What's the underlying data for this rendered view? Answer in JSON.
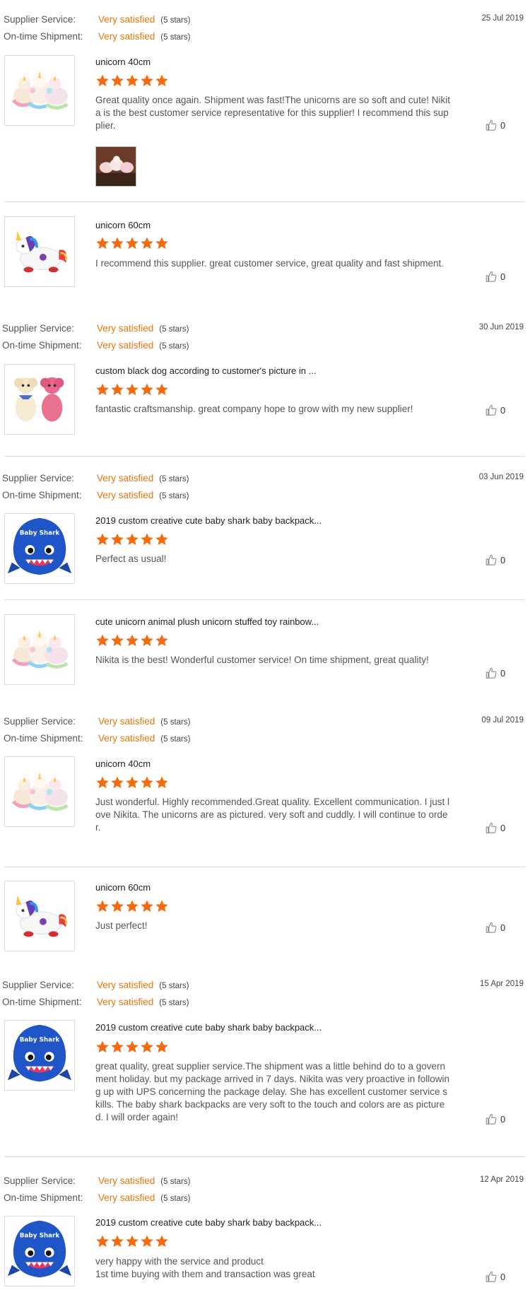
{
  "labels": {
    "supplier_service": "Supplier Service:",
    "on_time_shipment": "On-time Shipment:",
    "rating_text": "Very satisfied",
    "rating_stars": "(5 stars)"
  },
  "colors": {
    "accent": "#e8760c",
    "star": "#f26b10"
  },
  "reviews": [
    {
      "date": "25 Jul 2019",
      "product": "unicorn 40cm",
      "comment": "Great quality once again. Shipment was fast!The unicorns are so soft and cute!  Nikita is the best customer service representative for this supplier! I recommend this supplier.",
      "likes": "0",
      "stars": 5,
      "image": "unicorn-group"
    },
    {
      "date": "",
      "product": "unicorn 60cm",
      "comment": "I recommend this supplier. great customer service, great quality and fast shipment.",
      "likes": "0",
      "stars": 5,
      "image": "rainbow-unicorn"
    },
    {
      "date": "30 Jun 2019",
      "product": "custom black dog according to customer's picture in ...",
      "comment": "fantastic craftsmanship. great company hope to grow with my new supplier!",
      "likes": "0",
      "stars": 5,
      "image": "dogs"
    },
    {
      "date": "03 Jun 2019",
      "product": "2019 custom creative cute baby shark baby backpack...",
      "comment": "Perfect as usual!",
      "likes": "0",
      "stars": 5,
      "image": "shark"
    },
    {
      "date": "",
      "product": "cute unicorn animal plush unicorn stuffed toy rainbow...",
      "comment": "Nikita is the best! Wonderful customer service! On time shipment, great quality!",
      "likes": "0",
      "stars": 5,
      "image": "unicorn-group"
    },
    {
      "date": "09 Jul 2019",
      "product": "unicorn 40cm",
      "comment": "Just wonderful. Highly recommended.Great quality. Excellent communication. I just love Nikita. The unicorns are as pictured. very soft and cuddly. I will continue to order.",
      "likes": "0",
      "stars": 5,
      "image": "unicorn-group"
    },
    {
      "date": "",
      "product": "unicorn 60cm",
      "comment": "Just perfect!",
      "likes": "0",
      "stars": 5,
      "image": "rainbow-unicorn"
    },
    {
      "date": "15 Apr 2019",
      "product": "2019 custom creative cute baby shark baby backpack...",
      "comment": "great quality, great supplier service.The shipment was a little behind do to a government holiday. but my package arrived in 7 days. Nikita was very proactive in following up with UPS concerning the package delay. She has excellent customer service skills. The baby shark backpacks are very soft to the touch and colors are as pictured. I will order again!",
      "likes": "0",
      "stars": 5,
      "image": "shark"
    },
    {
      "date": "12 Apr 2019",
      "product": "2019 custom creative cute baby shark baby backpack...",
      "comment": "very happy with the service and product\n1st time buying with them and transaction was great",
      "likes": "0",
      "stars": 5,
      "image": "shark"
    }
  ],
  "shark_label": "Baby Shark"
}
